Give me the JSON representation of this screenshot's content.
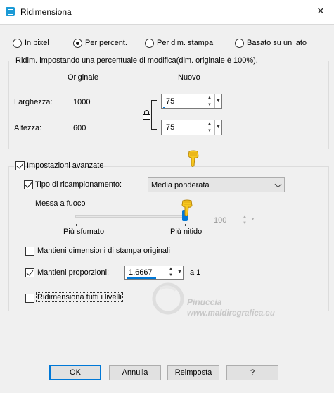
{
  "window": {
    "title": "Ridimensiona"
  },
  "mode_options": [
    {
      "label": "In pixel",
      "checked": false
    },
    {
      "label": "Per percent.",
      "checked": true
    },
    {
      "label": "Per dim. stampa",
      "checked": false
    },
    {
      "label": "Basato su un lato",
      "checked": false
    }
  ],
  "percent_group": {
    "title": "Ridim. impostando una percentuale di modifica(dim. originale è 100%).",
    "original_header": "Originale",
    "new_header": "Nuovo",
    "width_label": "Larghezza:",
    "width_original": "1000",
    "width_new": "75",
    "height_label": "Altezza:",
    "height_original": "600",
    "height_new": "75"
  },
  "advanced": {
    "label": "Impostazioni avanzate",
    "checked": true,
    "resample_label": "Tipo di ricampionamento:",
    "resample_checked": true,
    "resample_value": "Media ponderata",
    "sharpness_label": "Messa a fuoco",
    "sharpness_value": "100",
    "sharpness_level": 1.0,
    "slider_min_label": "Più sfumato",
    "slider_max_label": "Più nitido",
    "keep_print_label": "Mantieni dimensioni di stampa originali",
    "keep_print_checked": false,
    "keep_ratio_label": "Mantieni proporzioni:",
    "keep_ratio_checked": true,
    "ratio_value": "1,6667",
    "ratio_suffix": "a 1",
    "resize_layers_label": "Ridimensiona tutti i livelli",
    "resize_layers_checked": false
  },
  "watermark": {
    "line1": "Pinuccia",
    "line2": "www.maldiregrafica.eu"
  },
  "buttons": {
    "ok": "OK",
    "cancel": "Annulla",
    "reset": "Reimposta",
    "help": "?"
  }
}
